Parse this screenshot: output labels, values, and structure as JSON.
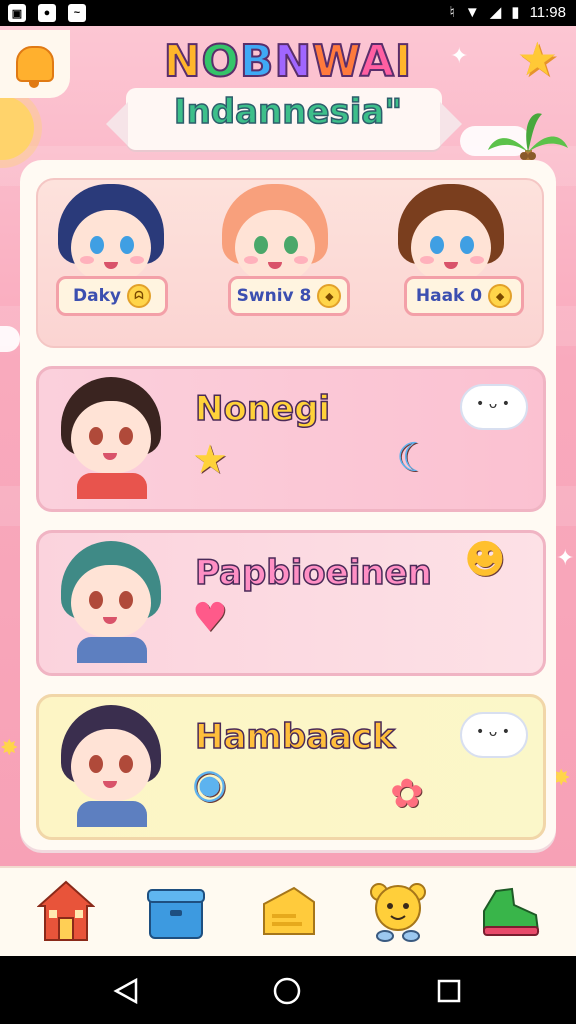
{
  "status_bar": {
    "time": "11:98",
    "icons": [
      "image-icon",
      "camera-icon",
      "message-icon"
    ],
    "right_icons": [
      "vibrate-icon",
      "wifi-icon",
      "signal-icon",
      "battery-icon"
    ]
  },
  "header": {
    "title": "NOBNWAI",
    "subtitle": "Indannesia\""
  },
  "characters": [
    {
      "name": "Daky",
      "badge": "ᗣ",
      "hair_color": "#2a3a7a",
      "eye_color": "#3f9fe3",
      "body_color": "#9ec5ef"
    },
    {
      "name": "Swniv 8",
      "badge": "◆",
      "hair_color": "#f8a07c",
      "eye_color": "#4aa86a",
      "body_color": "#f0d96a"
    },
    {
      "name": "Haak 0",
      "badge": "◆",
      "hair_color": "#7a3e1e",
      "eye_color": "#3f9fe3",
      "body_color": "#3a2a2a"
    }
  ],
  "menu_cards": [
    {
      "title": "Nonegi",
      "hair_color": "#3a2420",
      "body_color": "#e8544d",
      "icons": [
        "star-icon",
        "moon-icon",
        "cloud-icon"
      ]
    },
    {
      "title": "Papbioeinen",
      "hair_color": "#3f8a86",
      "body_color": "#5d7fc0",
      "icons": [
        "heart-icon",
        "smiley-icon"
      ]
    },
    {
      "title": "Hambaack",
      "hair_color": "#3a2e4e",
      "body_color": "#5d7fc0",
      "icons": [
        "swirl-icon",
        "blob-icon",
        "cloud-icon"
      ]
    }
  ],
  "bottom_nav": [
    {
      "name": "home",
      "icon": "house-icon",
      "color": "#e8543a"
    },
    {
      "name": "box",
      "icon": "box-icon",
      "color": "#3d9ae0"
    },
    {
      "name": "cheese",
      "icon": "cheese-icon",
      "color": "#ffcb3c"
    },
    {
      "name": "bear",
      "icon": "bear-icon",
      "color": "#ffcf3a"
    },
    {
      "name": "shoe",
      "icon": "shoe-icon",
      "color": "#39b54a"
    }
  ],
  "colors": {
    "panel": "#fffaf3",
    "background": "#f9aabd",
    "accent": "#ff5fa2"
  }
}
